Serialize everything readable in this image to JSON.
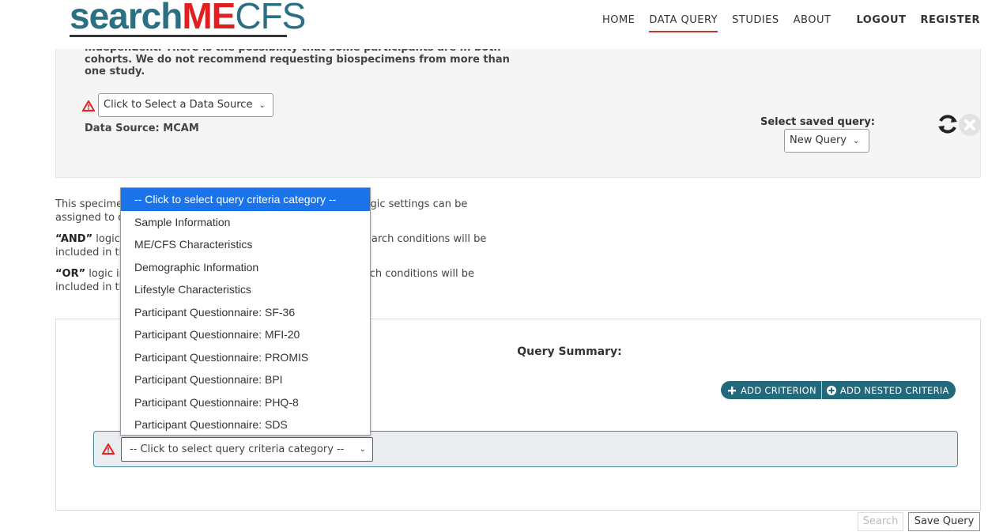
{
  "logo": {
    "part1": "search",
    "part2": "ME",
    "part3": "CFS"
  },
  "nav": {
    "home": "HOME",
    "data_query": "DATA QUERY",
    "studies": "STUDIES",
    "about": "ABOUT",
    "logout": "LOGOUT",
    "register": "REGISTER"
  },
  "data_source": {
    "note": "independent. There is the possibility that some participants are in both cohorts. We do not recommend requesting biospecimens from more than one study.",
    "select_value": "Click to Select a Data Source",
    "label": "Data Source: MCAM",
    "saved_query_label": "Select saved query:",
    "saved_query_value": "New Query"
  },
  "explain": {
    "p1": "This specimen query tool allows you to set search criteria. Logic settings can be assigned to determine the relationship between criteria.",
    "p2_bold": "“AND”",
    "p2": " logic indicates that only records that satisfy all the search conditions will be included in the results.",
    "p3_bold": "“OR”",
    "p3": " logic indicates that records that satisfy any of the search conditions will be included in the results."
  },
  "query": {
    "title": "Query Summary:",
    "add_criterion": "ADD CRITERION",
    "add_nested": "ADD NESTED CRITERIA",
    "criteria_select_value": "-- Click to select query criteria category --"
  },
  "dropdown_options": [
    "-- Click to select query criteria category --",
    "Sample Information",
    "ME/CFS Characteristics",
    "Demographic Information",
    "Lifestyle Characteristics",
    "Participant Questionnaire: SF-36",
    "Participant Questionnaire: MFI-20",
    "Participant Questionnaire: PROMIS",
    "Participant Questionnaire: BPI",
    "Participant Questionnaire: PHQ-8",
    "Participant Questionnaire: SDS"
  ],
  "buttons": {
    "search": "Search",
    "save_query": "Save Query"
  },
  "colors": {
    "brand_teal": "#2b6f82",
    "brand_red": "#e02020",
    "highlight": "#1a73e8",
    "warning": "#e02020"
  }
}
